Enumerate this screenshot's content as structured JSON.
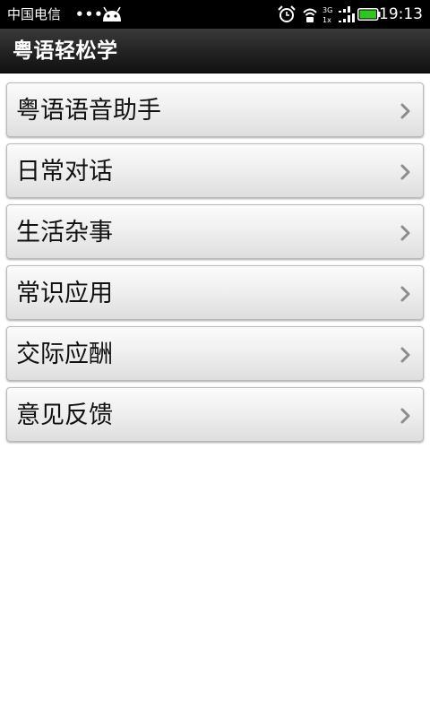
{
  "status_bar": {
    "carrier": "中国电信",
    "dots": "•••",
    "time": "19:13",
    "network": "3G",
    "network_sub": "1x",
    "icons": [
      "android-icon",
      "alarm-icon",
      "wifi-icon",
      "signal-icon",
      "battery-icon"
    ],
    "battery_color": "#2fc51f"
  },
  "header": {
    "title": "粤语轻松学"
  },
  "menu": {
    "items": [
      {
        "label": "粤语语音助手"
      },
      {
        "label": "日常对话"
      },
      {
        "label": "生活杂事"
      },
      {
        "label": "常识应用"
      },
      {
        "label": "交际应酬"
      },
      {
        "label": "意见反馈"
      }
    ],
    "chevron_icon": "chevron-right-icon"
  }
}
